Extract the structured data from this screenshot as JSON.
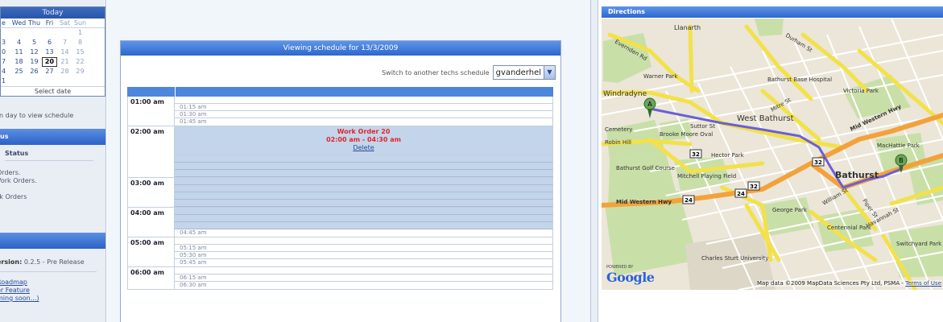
{
  "calendar": {
    "month_label": "Today",
    "day_headers": [
      "e",
      "Wed",
      "Thu",
      "Fri",
      "Sat",
      "Sun"
    ],
    "weeks": [
      [
        "",
        "",
        "",
        "",
        "",
        "1"
      ],
      [
        "3",
        "4",
        "5",
        "6",
        "7",
        "8"
      ],
      [
        "0",
        "11",
        "12",
        "13",
        "14",
        "15"
      ],
      [
        "7",
        "18",
        "19",
        "20",
        "21",
        "22"
      ],
      [
        "4",
        "25",
        "26",
        "27",
        "28",
        "29"
      ],
      [
        "1",
        "",
        "",
        "",
        "",
        ""
      ]
    ],
    "selected_day": "20",
    "footer": "Select date",
    "hint": "n day to view schedule"
  },
  "status_section": {
    "header": "us",
    "title": "Status",
    "items": [
      "Orders.",
      "Vork Orders.",
      "rk Orders"
    ]
  },
  "about_section": {
    "header": "",
    "version_label": "ersion:",
    "version_value": "0.2.5 - Pre Release",
    "links": [
      "Roadmap",
      "or Feature",
      "ming soon...)"
    ]
  },
  "schedule": {
    "title": "Viewing schedule for 13/3/2009",
    "switch_label": "Switch to another techs schedule",
    "tech_selected": "gvanderhel",
    "hours": [
      {
        "label": "01:00 am",
        "slots": [
          "",
          "01:15 am",
          "01:30 am",
          "01:45 am"
        ]
      },
      {
        "label": "02:00 am",
        "work_order": {
          "title": "Work Order 20",
          "time": "02:00 am - 04:30 am",
          "delete": "Delete"
        },
        "booked": 4
      },
      {
        "label": "03:00 am",
        "booked_rows": 4
      },
      {
        "label": "04:00 am",
        "booked_rows": 3,
        "slots_tail": [
          "04:45 am"
        ]
      },
      {
        "label": "05:00 am",
        "slots": [
          "",
          "05:15 am",
          "05:30 am",
          "05:45 am"
        ]
      },
      {
        "label": "06:00 am",
        "slots": [
          "",
          "06:15 am",
          "06:30 am"
        ]
      }
    ]
  },
  "directions": {
    "header": "Directions",
    "marker_a": "A",
    "marker_b": "B",
    "labels": {
      "llanarth": "Llanarth",
      "evernden": "Evernden Rd",
      "durham": "Durham St",
      "warner": "Warner Park",
      "hospital": "Bathurst Base Hospital",
      "victoria": "Victoria Park",
      "windradyne": "Windradyne",
      "mitre": "Mitre St",
      "west_bathurst": "West Bathurst",
      "bathurst_west": "Bathurst",
      "cemetery": "Cemetery",
      "brooke": "Brooke Moore Oval",
      "suttor": "Suttor St",
      "robin": "Robin Hill",
      "hector": "Hector Park",
      "golf": "Bathurst Golf Course",
      "mitchell": "Mitchell Playing Field",
      "machattie": "MacHattie Park",
      "bathurst": "Bathurst",
      "midwestern": "Mid Western Hwy",
      "midwestern2": "Mid Western Hwy",
      "george": "George Park",
      "centennial": "Centennial Park",
      "william": "William St",
      "havannah": "Havannah St",
      "switchyard": "Switchyard Park",
      "csu": "Charles Sturt University",
      "piper": "Piper St",
      "sh32a": "32",
      "sh32b": "32",
      "sh32c": "32",
      "sh24a": "24",
      "sh24b": "24"
    },
    "powered_by": "POWERED BY",
    "google": "Google",
    "copyright": "Map data ©2009 MapData Sciences Pty Ltd, PSMA -",
    "terms": "Terms of Use"
  }
}
